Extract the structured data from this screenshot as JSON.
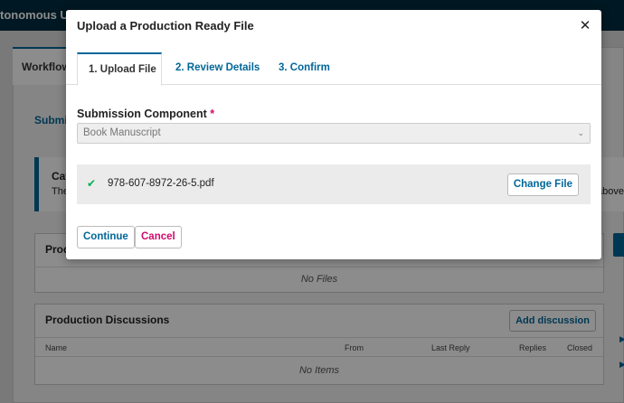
{
  "background": {
    "site_title": "tonomous U",
    "workflow_tab": "Workflow",
    "subtab": "Submis",
    "notice": {
      "title": "Cat",
      "body": "The",
      "body_right": "above"
    },
    "production_grid": {
      "title": "Produ",
      "empty_text": "No Files"
    },
    "discussions": {
      "title": "Production Discussions",
      "add_button": "Add discussion",
      "columns": [
        "Name",
        "From",
        "Last Reply",
        "Replies",
        "Closed"
      ],
      "empty_text": "No Items"
    }
  },
  "modal": {
    "title": "Upload a Production Ready File",
    "close_icon": "close-icon",
    "tabs": [
      {
        "label": "1. Upload File",
        "active": true
      },
      {
        "label": "2. Review Details",
        "active": false
      },
      {
        "label": "3. Confirm",
        "active": false
      }
    ],
    "field": {
      "label": "Submission Component",
      "required_mark": "*",
      "selected_value": "Book Manuscript"
    },
    "file": {
      "name": "978-607-8972-26-5.pdf",
      "change_label": "Change File"
    },
    "actions": {
      "continue_label": "Continue",
      "cancel_label": "Cancel"
    }
  },
  "colors": {
    "primary": "#006798",
    "danger": "#d00a6c",
    "success": "#00b24e",
    "header": "#002c40"
  }
}
